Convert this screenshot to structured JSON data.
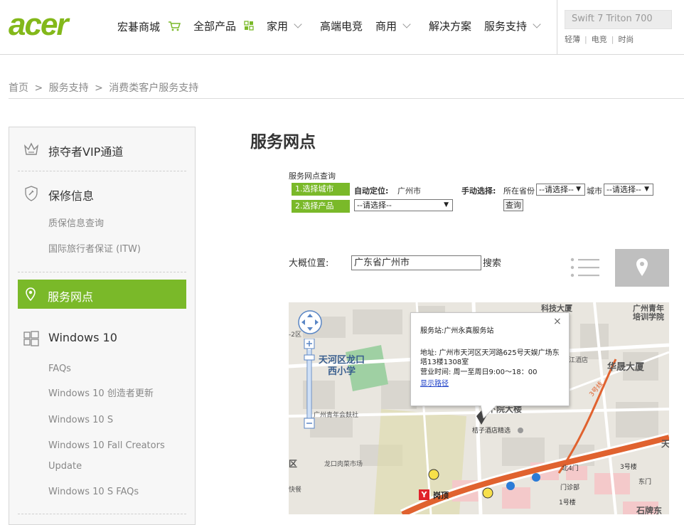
{
  "header": {
    "logo_text": "acer",
    "nav": [
      {
        "label": "宏碁商城",
        "icon": "cart-icon"
      },
      {
        "label": "全部产品",
        "icon": "grid-icon"
      },
      {
        "label": "家用",
        "icon": "chevron-down-icon"
      },
      {
        "label": "高端电竞"
      },
      {
        "label": "商用",
        "icon": "chevron-down-icon"
      },
      {
        "label": "解决方案"
      },
      {
        "label": "服务支持",
        "icon": "chevron-down-icon"
      }
    ],
    "search_placeholder": "Swift 7 Triton 700",
    "quick_links": [
      "轻薄",
      "电竞",
      "时尚"
    ]
  },
  "breadcrumb": {
    "home": "首页",
    "sep": ">",
    "level2": "服务支持",
    "level3": "消费类客户服务支持"
  },
  "sidebar": {
    "vip": "掠夺者VIP通道",
    "warranty": "保修信息",
    "warranty_items": [
      "质保信息查询",
      "国际旅行者保证 (ITW)"
    ],
    "service_points": "服务网点",
    "windows": "Windows 10",
    "windows_items": [
      "FAQs",
      "Windows 10 创造者更新",
      "Windows 10 S",
      "Windows 10 Fall Creators",
      "Update",
      "Windows 10 S FAQs"
    ]
  },
  "main": {
    "title": "服务网点",
    "query_label": "服务网点查询",
    "step1": "1.选择城市",
    "step2": "2.选择产品",
    "auto_label": "自动定位:",
    "auto_value": "广州市",
    "manual_label": "手动选择:",
    "province_label": "所在省份",
    "city_label": "城市",
    "select_placeholder": "--请选择--",
    "product_placeholder": "--请选择--",
    "query_button": "查询",
    "approx_label": "大概位置:",
    "location_value": "广东省广州市",
    "search_button": "搜索"
  },
  "map": {
    "labels": {
      "tianhe_school_1": "天河区龙口",
      "tianhe_school_2": "西小学",
      "youth_club": "广州青年会麸社",
      "meat_market": "龙口肉菜市场",
      "hotel": "桔子酒店精选",
      "huazhan": "华晟大厦",
      "tech_building": "科技大厦",
      "training_1": "广州青年",
      "training_2": "培训学院",
      "north4": "北4门",
      "clinic": "门诊部",
      "building3": "3号楼",
      "building1": "1号楼",
      "east_gate": "东门",
      "gangding": "岗顶",
      "stone_card": "石牌东",
      "district": "区",
      "fast_food": "快餐",
      "hotel_left": "江酒店",
      "tian": "天",
      "line3": "3号线",
      "building_blur": "下院大楼",
      "district_2": "-2区"
    },
    "popup": {
      "title": "服务站:广州永真服务站",
      "address": "地址: 广州市天河区天河路625号天娱广场东塔13楼1308室",
      "hours": "营业时间: 周一至周日9:00～18：00",
      "route_link": "显示路径"
    }
  },
  "colors": {
    "accent": "#7ab929",
    "logo": "#83b81a",
    "metro_line": "#e0622f"
  }
}
